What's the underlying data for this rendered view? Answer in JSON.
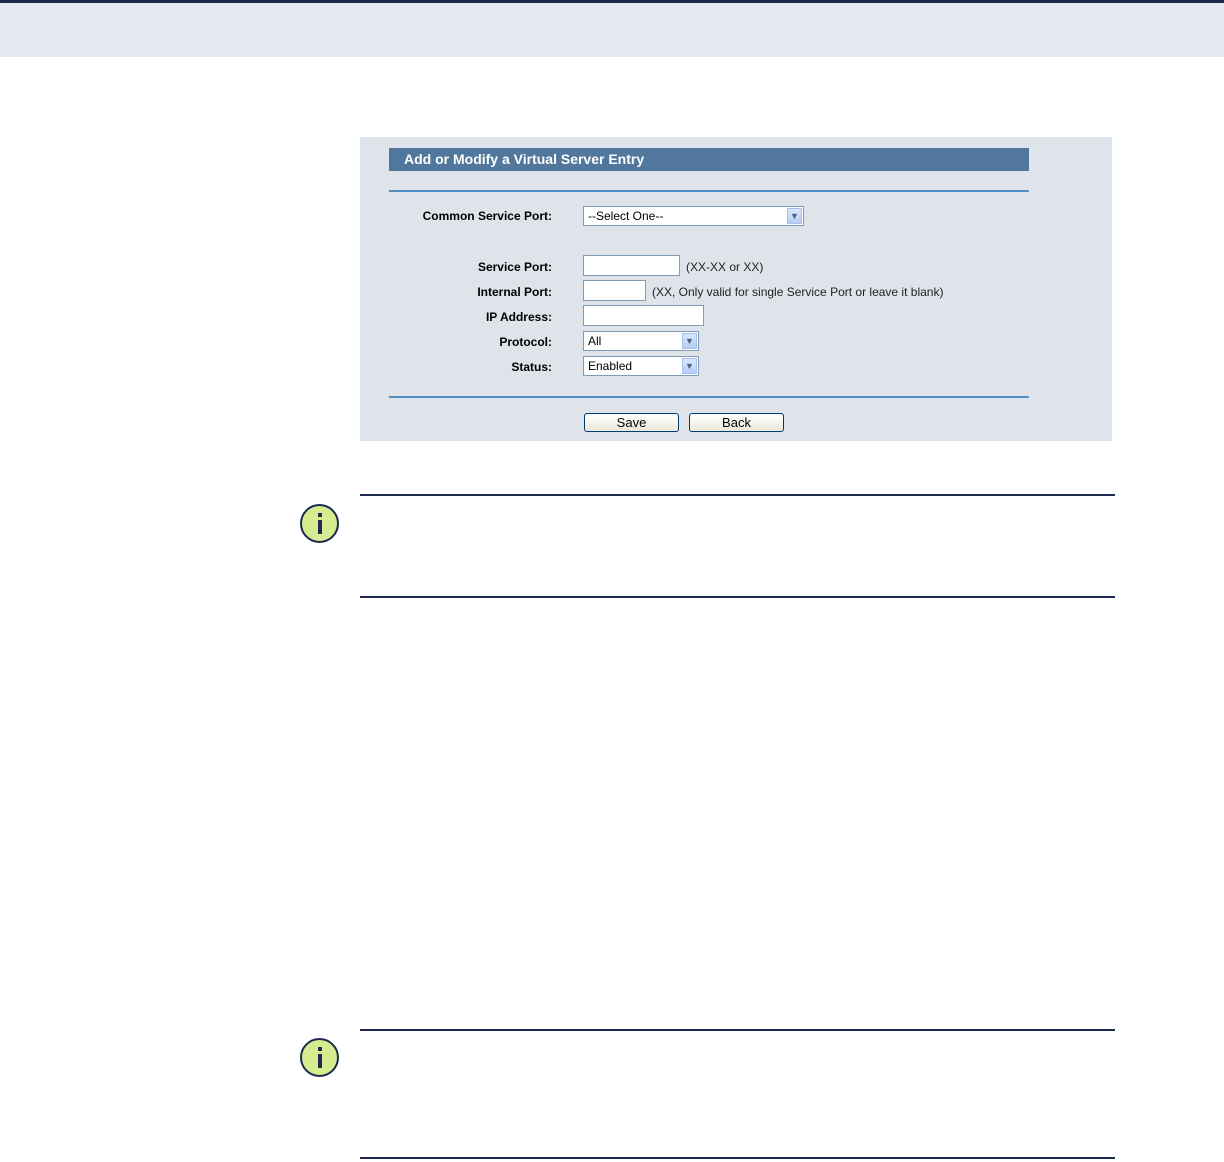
{
  "panel": {
    "title": "Add or Modify a Virtual Server Entry",
    "common_service_port": {
      "label": "Common Service Port:",
      "selected": "--Select One--"
    },
    "service_port": {
      "label": "Service Port:",
      "value": "",
      "hint": "(XX-XX or XX)"
    },
    "internal_port": {
      "label": "Internal Port:",
      "value": "",
      "hint": "(XX, Only valid for single Service Port or leave it blank)"
    },
    "ip_address": {
      "label": "IP Address:",
      "value": ""
    },
    "protocol": {
      "label": "Protocol:",
      "selected": "All"
    },
    "status": {
      "label": "Status:",
      "selected": "Enabled"
    },
    "save_label": "Save",
    "back_label": "Back"
  },
  "icons": {
    "note_icon": "info-icon",
    "dropdown_icon": "chevron-down-icon"
  },
  "colors": {
    "title_bar": "#52779c",
    "panel_bg": "#dfe3ea",
    "rule": "#4f8fc4",
    "note_rule": "#1b2a4e",
    "note_icon_fill": "#d6ec8f"
  }
}
